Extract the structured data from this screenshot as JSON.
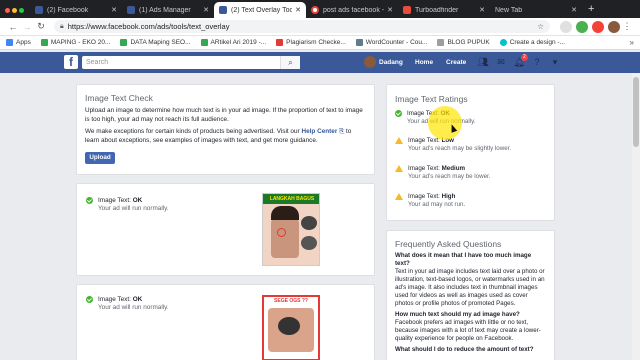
{
  "browser": {
    "tabs": [
      {
        "label": "(2) Facebook",
        "favcolor": "#3b5998"
      },
      {
        "label": "(1) Ads Manager",
        "favcolor": "#3b5998"
      },
      {
        "label": "(2) Text Overlay Tool",
        "favcolor": "#3b5998",
        "active": true
      },
      {
        "label": "post ads facebook -",
        "favcolor": "#ea4335"
      },
      {
        "label": "Turboadfinder",
        "favcolor": "#e74c3c"
      },
      {
        "label": "New Tab",
        "favcolor": "#888"
      }
    ],
    "url": "https://www.facebook.com/ads/tools/text_overlay",
    "bookmarks": [
      {
        "label": "Apps",
        "color": "#4285f4"
      },
      {
        "label": "MAPING - EKO 20...",
        "color": "#34a853"
      },
      {
        "label": "DATA Maping SEO...",
        "color": "#34a853"
      },
      {
        "label": "ARtikel Ari 2019 -...",
        "color": "#34a853"
      },
      {
        "label": "Plagiarism Checke...",
        "color": "#e53935"
      },
      {
        "label": "WordCounter - Cou...",
        "color": "#607d8b"
      },
      {
        "label": "BLOG PUPUK",
        "color": "#9e9e9e"
      },
      {
        "label": "Create a design -...",
        "color": "#00c4cc"
      }
    ],
    "more": "»"
  },
  "fb": {
    "logo": "f",
    "search_placeholder": "Search",
    "user": "Dadang",
    "home": "Home",
    "create": "Create",
    "notifications": "2"
  },
  "check": {
    "title": "Image Text Check",
    "p1": "Upload an image to determine how much text is in your ad image. If the proportion of text to image is too high, your ad may not reach its full audience.",
    "p2_pre": "We make exceptions for certain kinds of products being advertised. Visit our",
    "p2_link": "Help Center",
    "p2_post": "to learn about exceptions, see examples of images with text, and get more guidance.",
    "upload": "Upload"
  },
  "results": [
    {
      "label": "Image Text:",
      "value": "OK",
      "sub": "Your ad will run normally.",
      "thumb_caption": "LANGKAH BAGUS"
    },
    {
      "label": "Image Text:",
      "value": "OK",
      "sub": "Your ad will run normally.",
      "thumb_caption": "SEGE OGS ??"
    }
  ],
  "ratings": {
    "title": "Image Text Ratings",
    "items": [
      {
        "label": "Image Text:",
        "value": "OK",
        "sub": "Your ad will run normally.",
        "icon": "ok"
      },
      {
        "label": "Image Text:",
        "value": "Low",
        "sub": "Your ad's reach may be slightly lower.",
        "icon": "warn"
      },
      {
        "label": "Image Text:",
        "value": "Medium",
        "sub": "Your ad's reach may be lower.",
        "icon": "warn"
      },
      {
        "label": "Image Text:",
        "value": "High",
        "sub": "Your ad may not run.",
        "icon": "warn"
      }
    ]
  },
  "faq": {
    "title": "Frequently Asked Questions",
    "q1": "What does it mean that I have too much image text?",
    "a1": "Text in your ad image includes text laid over a photo or illustration, text-based logos, or watermarks used in an ad's image. It also includes text in thumbnail images used for videos as well as images used as cover photos or profile photos of promoted Pages.",
    "q2": "How much text should my ad image have?",
    "a2": "Facebook prefers ad images with little or no text, because images with a lot of text may create a lower-quality experience for people on Facebook.",
    "q3": "What should I do to reduce the amount of text?"
  }
}
